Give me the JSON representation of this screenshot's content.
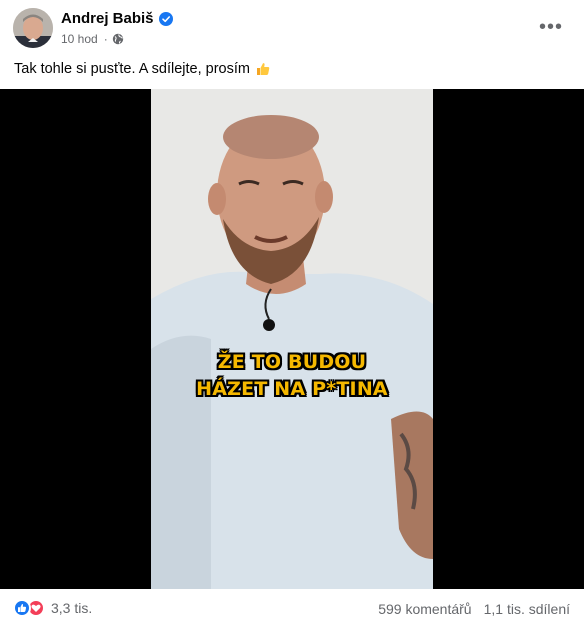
{
  "post": {
    "author": "Andrej Babiš",
    "timestamp": "10 hod",
    "visibility_icon": "globe-icon",
    "caption": "Tak tohle si pusťte. A sdílejte, prosím",
    "caption_emoji": "thumbs-up-icon"
  },
  "video": {
    "subtitle_line1": "ŽE TO BUDOU",
    "subtitle_line2": "HÁZET NA P*TINA",
    "subtitle_color": "#f5b800"
  },
  "footer": {
    "reaction_icons": [
      "like-icon",
      "love-icon"
    ],
    "reaction_count": "3,3 tis.",
    "comments": "599 komentářů",
    "shares": "1,1 tis. sdílení"
  },
  "colors": {
    "brand_blue": "#1877f2",
    "love_red": "#f33e58",
    "secondary_text": "#65676b"
  }
}
